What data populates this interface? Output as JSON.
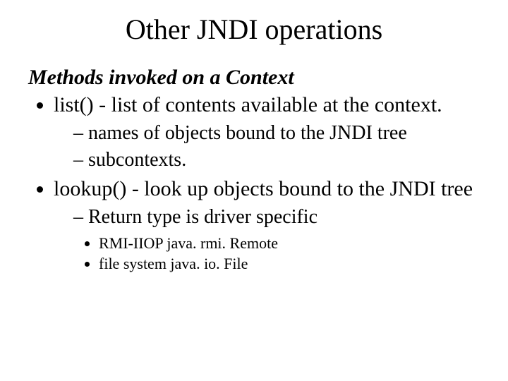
{
  "title": "Other JNDI operations",
  "subhead": "Methods invoked on a Context",
  "bullets": [
    {
      "text": "list() - list of contents available at the context.",
      "sub": [
        {
          "text": "names of objects bound to the JNDI tree"
        },
        {
          "text": "subcontexts."
        }
      ]
    },
    {
      "text": "lookup() - look up objects bound to the JNDI tree",
      "sub": [
        {
          "text": "Return type is driver specific",
          "sub": [
            {
              "text": "RMI-IIOP java. rmi. Remote"
            },
            {
              "text": "file system java. io. File"
            }
          ]
        }
      ]
    }
  ]
}
